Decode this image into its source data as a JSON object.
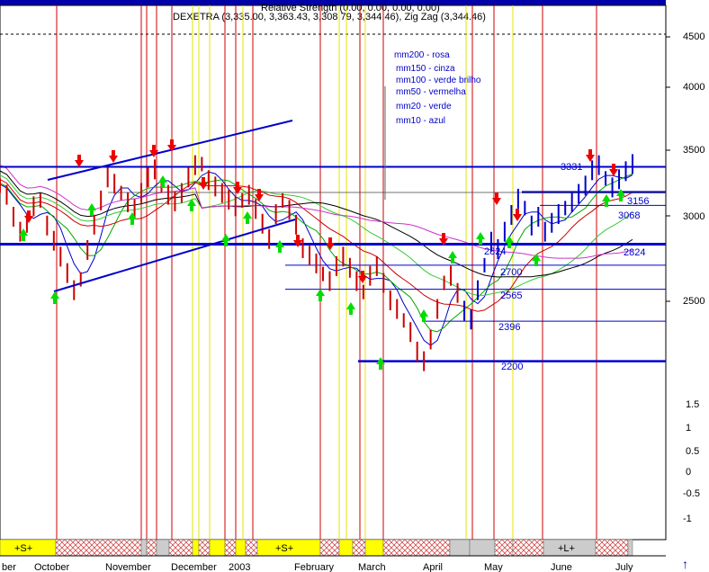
{
  "chart_data": {
    "type": "line",
    "title": "DEXETRA (3,335.00, 3,363.43, 3,308.79, 3,344.46), Zig Zag (3,344.46)",
    "overlay_title": "Relative Strength (0.00, 0.00, 0.00, 0.00)",
    "yaxis_price": {
      "scale": "log",
      "ticks": [
        2500,
        3000,
        3500,
        4000,
        4500
      ]
    },
    "yaxis_indicator": {
      "ticks": [
        1.5,
        1.0,
        0.5,
        0.0,
        -0.5,
        -1.0
      ]
    },
    "xaxis_labels": [
      "ber",
      "October",
      "November",
      "December",
      "2003",
      "February",
      "March",
      "April",
      "May",
      "June",
      "July"
    ],
    "legend": [
      "mm200 - rosa",
      "mm150 - cinza",
      "mm100 - verde brilho",
      "mm50 - vermelha",
      "mm20 - verde",
      "mm10 - azul"
    ],
    "price_levels": [
      {
        "label": "3331",
        "value": 3331
      },
      {
        "label": "3156",
        "value": 3156
      },
      {
        "label": "3068",
        "value": 3068
      },
      {
        "label": "2824",
        "value": 2824
      },
      {
        "label": "2824",
        "value": 2824
      },
      {
        "label": "2700",
        "value": 2700
      },
      {
        "label": "2565",
        "value": 2565
      },
      {
        "label": "2396",
        "value": 2396
      },
      {
        "label": "2200",
        "value": 2200
      }
    ],
    "series": [
      {
        "name": "",
        "type": "bar_price",
        "values": [
          3200,
          3150,
          3000,
          2900,
          2950,
          3050,
          3100,
          2950,
          2850,
          2750,
          2650,
          2550,
          2620,
          2800,
          2950,
          3100,
          3250,
          3200,
          3150,
          3100,
          3050,
          3150,
          3250,
          3300,
          3200,
          3150,
          3100,
          3150,
          3250,
          3330,
          3350,
          3250,
          3200,
          3150,
          3100,
          3050,
          3100,
          3150,
          3050,
          2950,
          2850,
          3000,
          3100,
          3050,
          2950,
          2800,
          2750,
          2700,
          2650,
          2620,
          2700,
          2750,
          2680,
          2600,
          2550,
          2650,
          2700,
          2600,
          2500,
          2450,
          2400,
          2350,
          2250,
          2200,
          2300,
          2450,
          2600,
          2650,
          2550,
          2450,
          2400,
          2550,
          2700,
          2850,
          2800,
          2900,
          3000,
          3100,
          3050,
          2950,
          3000,
          2900,
          2950,
          3000,
          3050,
          3100,
          3150,
          3200,
          3300,
          3330,
          3250,
          3200,
          3250,
          3300,
          3344
        ]
      }
    ],
    "markers": {
      "buy_count": 18,
      "sell_count": 16
    },
    "signals": [
      "+S+",
      "+S+",
      "+L+"
    ],
    "grid": false
  }
}
